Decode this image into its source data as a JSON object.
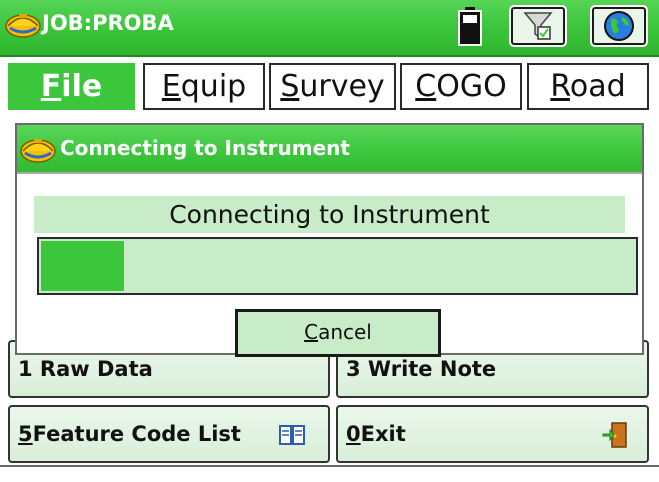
{
  "titlebar": {
    "title": "JOB:PROBA",
    "icons": [
      "hardhat-logo-icon",
      "battery-icon",
      "filter-icon",
      "globe-icon"
    ]
  },
  "menu": {
    "items": [
      {
        "label_first": "F",
        "label_rest": "ile",
        "active": true
      },
      {
        "label_first": "E",
        "label_rest": "quip",
        "active": false
      },
      {
        "label_first": "S",
        "label_rest": "urvey",
        "active": false
      },
      {
        "label_first": "C",
        "label_rest": "OGO",
        "active": false
      },
      {
        "label_first": "R",
        "label_rest": "oad",
        "active": false
      }
    ]
  },
  "background_buttons": {
    "partial_left": "1 Raw Data",
    "partial_right": "3 Write Note",
    "feature_code": {
      "number": "5",
      "label": "Feature Code List"
    },
    "exit": {
      "number": "0",
      "label": "Exit"
    }
  },
  "dialog": {
    "title": "Connecting to Instrument",
    "status": "Connecting to Instrument",
    "progress": 0.14,
    "cancel_first": "C",
    "cancel_rest": "ancel"
  },
  "colors": {
    "accent_green": "#3cc63c",
    "pale_green": "#c8ecc8"
  }
}
